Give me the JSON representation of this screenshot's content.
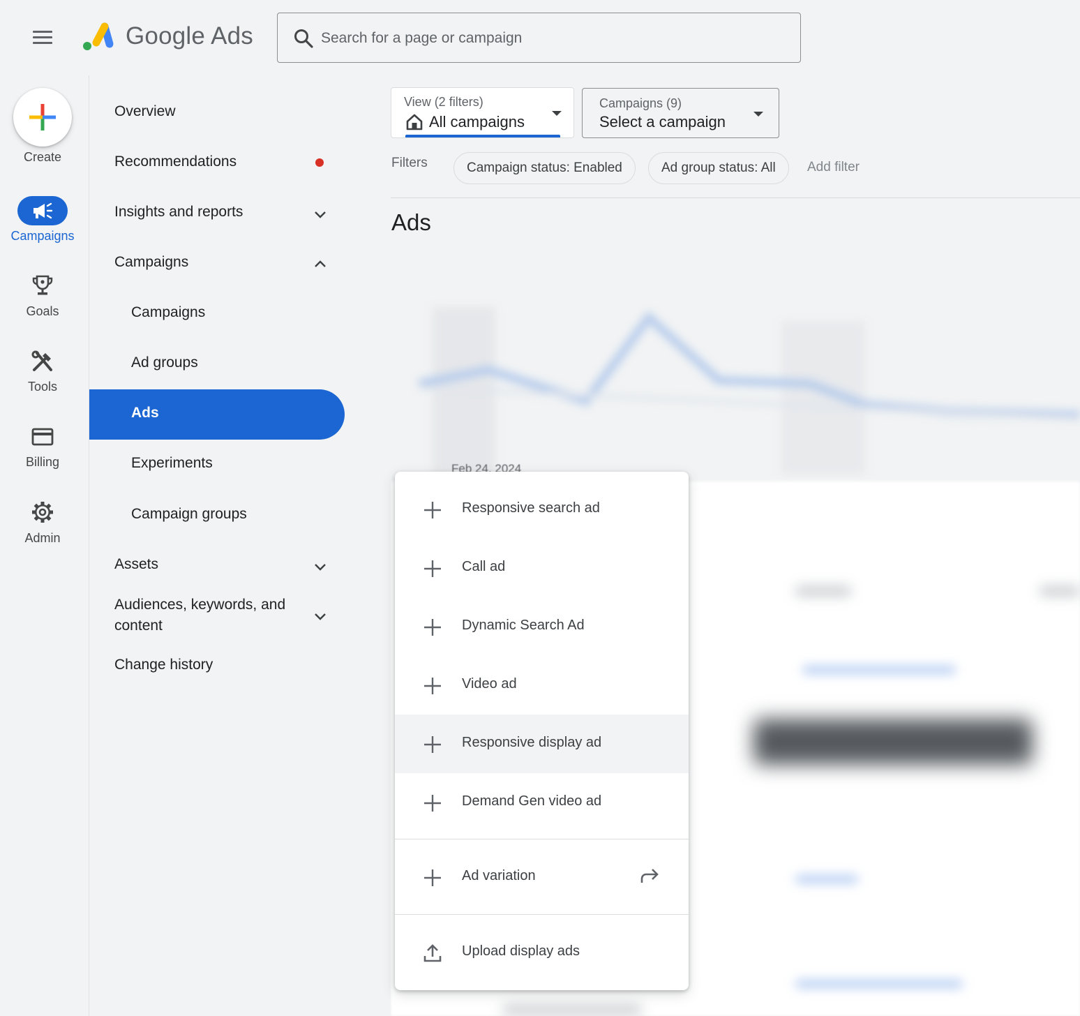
{
  "header": {
    "brand_google": "Google",
    "brand_ads": "Ads",
    "search_placeholder": "Search for a page or campaign"
  },
  "rail": {
    "create": "Create",
    "campaigns": "Campaigns",
    "goals": "Goals",
    "tools": "Tools",
    "billing": "Billing",
    "admin": "Admin"
  },
  "nav": {
    "overview": "Overview",
    "recommendations": "Recommendations",
    "insights": "Insights and reports",
    "campaigns_section": "Campaigns",
    "campaigns": "Campaigns",
    "ad_groups": "Ad groups",
    "ads": "Ads",
    "experiments": "Experiments",
    "campaign_groups": "Campaign groups",
    "assets": "Assets",
    "audiences": "Audiences, keywords, and content",
    "change_history": "Change history"
  },
  "view_dropdown": {
    "label": "View (2 filters)",
    "value": "All campaigns"
  },
  "campaign_dropdown": {
    "label": "Campaigns (9)",
    "value": "Select a campaign"
  },
  "filters": {
    "label": "Filters",
    "chips": [
      "Campaign status: Enabled",
      "Ad group status: All"
    ],
    "add": "Add filter"
  },
  "page_title": "Ads",
  "chart_date": "Feb 24, 2024",
  "menu": {
    "items": [
      "Responsive search ad",
      "Call ad",
      "Dynamic Search Ad",
      "Video ad",
      "Responsive display ad",
      "Demand Gen video ad"
    ],
    "ad_variation": "Ad variation",
    "upload": "Upload display ads"
  },
  "colors": {
    "accent": "#1b66d2",
    "notification_dot": "#d93025",
    "background": "#f1f3f4"
  },
  "icons": {
    "menu": "hamburger-icon",
    "search": "search-icon",
    "create": "plus-multicolor-icon",
    "campaigns": "megaphone-icon",
    "goals": "trophy-icon",
    "tools": "tools-icon",
    "billing": "credit-card-icon",
    "admin": "gear-icon",
    "home": "home-icon",
    "expand": "chevron-down-icon",
    "collapse": "chevron-up-icon",
    "add": "plus-icon",
    "forward": "forward-arrow-icon",
    "upload": "upload-icon"
  }
}
